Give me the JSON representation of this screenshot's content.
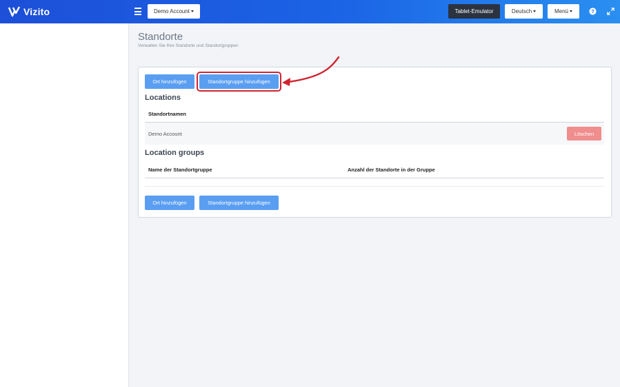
{
  "topbar": {
    "brand": "Vizito",
    "account_label": "Demo Account",
    "tablet_label": "Tablet-Emulator",
    "language_label": "Deutsch",
    "menu_label": "Menü",
    "brand_color": "#1d4fd8"
  },
  "header": {
    "title": "Standorte",
    "subtitle": "Verwalten Sie Ihre Standorte und Standortgruppen"
  },
  "actions": {
    "add_location": "Ort hinzufügen",
    "add_location_group": "Standortgruppe hinzufügen"
  },
  "locations": {
    "title": "Locations",
    "column_name": "Standortnamen",
    "rows": [
      {
        "name": "Demo Account",
        "delete_label": "Löschen"
      }
    ]
  },
  "location_groups": {
    "title": "Location groups",
    "column_name": "Name der Standortgruppe",
    "column_count": "Anzahl der Standorte in der Gruppe"
  },
  "annotation": {
    "highlight_color": "#d0232f"
  }
}
